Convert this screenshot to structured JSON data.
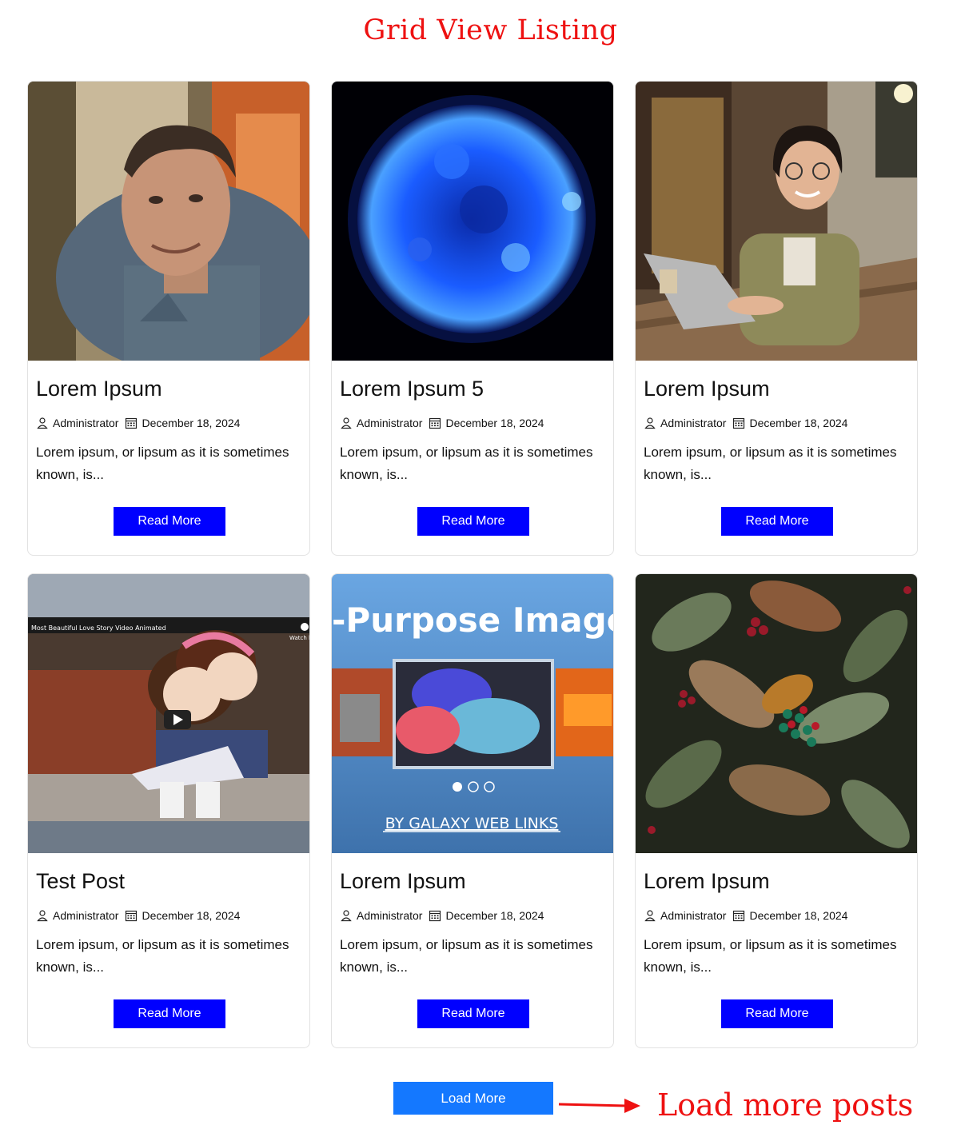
{
  "page": {
    "title": "Grid View Listing"
  },
  "colors": {
    "accent_red": "#ee1111",
    "button_blue": "#0000ff",
    "load_more_blue": "#1478ff"
  },
  "posts": [
    {
      "title": "Lorem Ipsum",
      "author": "Administrator",
      "date": "December 18, 2024",
      "excerpt": "Lorem ipsum, or lipsum as it is sometimes known, is...",
      "read_more": "Read More",
      "image": "portrait of smiling man"
    },
    {
      "title": "Lorem Ipsum 5",
      "author": "Administrator",
      "date": "December 18, 2024",
      "excerpt": "Lorem ipsum, or lipsum as it is sometimes known, is...",
      "read_more": "Read More",
      "image": "blue sun"
    },
    {
      "title": "Lorem Ipsum",
      "author": "Administrator",
      "date": "December 18, 2024",
      "excerpt": "Lorem ipsum, or lipsum as it is sometimes known, is...",
      "read_more": "Read More",
      "image": "woman with laptop at cafe"
    },
    {
      "title": "Test Post",
      "author": "Administrator",
      "date": "December 18, 2024",
      "excerpt": "Lorem ipsum, or lipsum as it is sometimes known, is...",
      "read_more": "Read More",
      "image": "animated video thumbnail",
      "video_caption": "Most Beautiful Love Story Video Animated",
      "video_watch": "Watch l"
    },
    {
      "title": "Lorem Ipsum",
      "author": "Administrator",
      "date": "December 18, 2024",
      "excerpt": "Lorem ipsum, or lipsum as it is sometimes known, is...",
      "read_more": "Read More",
      "image": "image slider banner",
      "banner_heading": "-Purpose Image -",
      "banner_footer": "BY GALAXY WEB LINKS"
    },
    {
      "title": "Lorem Ipsum",
      "author": "Administrator",
      "date": "December 18, 2024",
      "excerpt": "Lorem ipsum, or lipsum as it is sometimes known, is...",
      "read_more": "Read More",
      "image": "leaves with red berries"
    }
  ],
  "load_more": {
    "label": "Load More"
  },
  "annotation": {
    "text": "Load more posts"
  }
}
